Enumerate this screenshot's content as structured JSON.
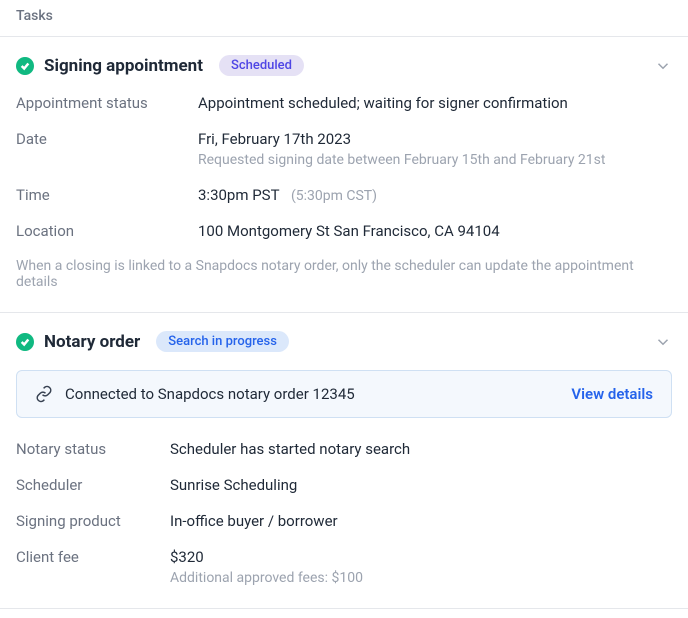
{
  "header": {
    "title": "Tasks"
  },
  "signing": {
    "title": "Signing appointment",
    "badge": "Scheduled",
    "appointment_status": {
      "label": "Appointment status",
      "value": "Appointment scheduled; waiting for signer confirmation"
    },
    "date": {
      "label": "Date",
      "value": "Fri, February 17th 2023",
      "note": "Requested signing date between February 15th and February 21st"
    },
    "time": {
      "label": "Time",
      "value": "3:30pm PST",
      "alt": "(5:30pm CST)"
    },
    "location": {
      "label": "Location",
      "value": "100 Montgomery St San Francisco, CA 94104"
    },
    "footnote": "When a closing is linked to a Snapdocs notary order, only the scheduler can update the appointment details"
  },
  "notary": {
    "title": "Notary order",
    "badge": "Search in progress",
    "connected": {
      "text": "Connected to Snapdocs notary order 12345",
      "action": "View details"
    },
    "status": {
      "label": "Notary status",
      "value": "Scheduler has started notary search"
    },
    "scheduler": {
      "label": "Scheduler",
      "value": "Sunrise Scheduling"
    },
    "product": {
      "label": "Signing product",
      "value": "In-office buyer / borrower"
    },
    "fee": {
      "label": "Client fee",
      "value": "$320",
      "note": "Additional approved fees: $100"
    }
  }
}
